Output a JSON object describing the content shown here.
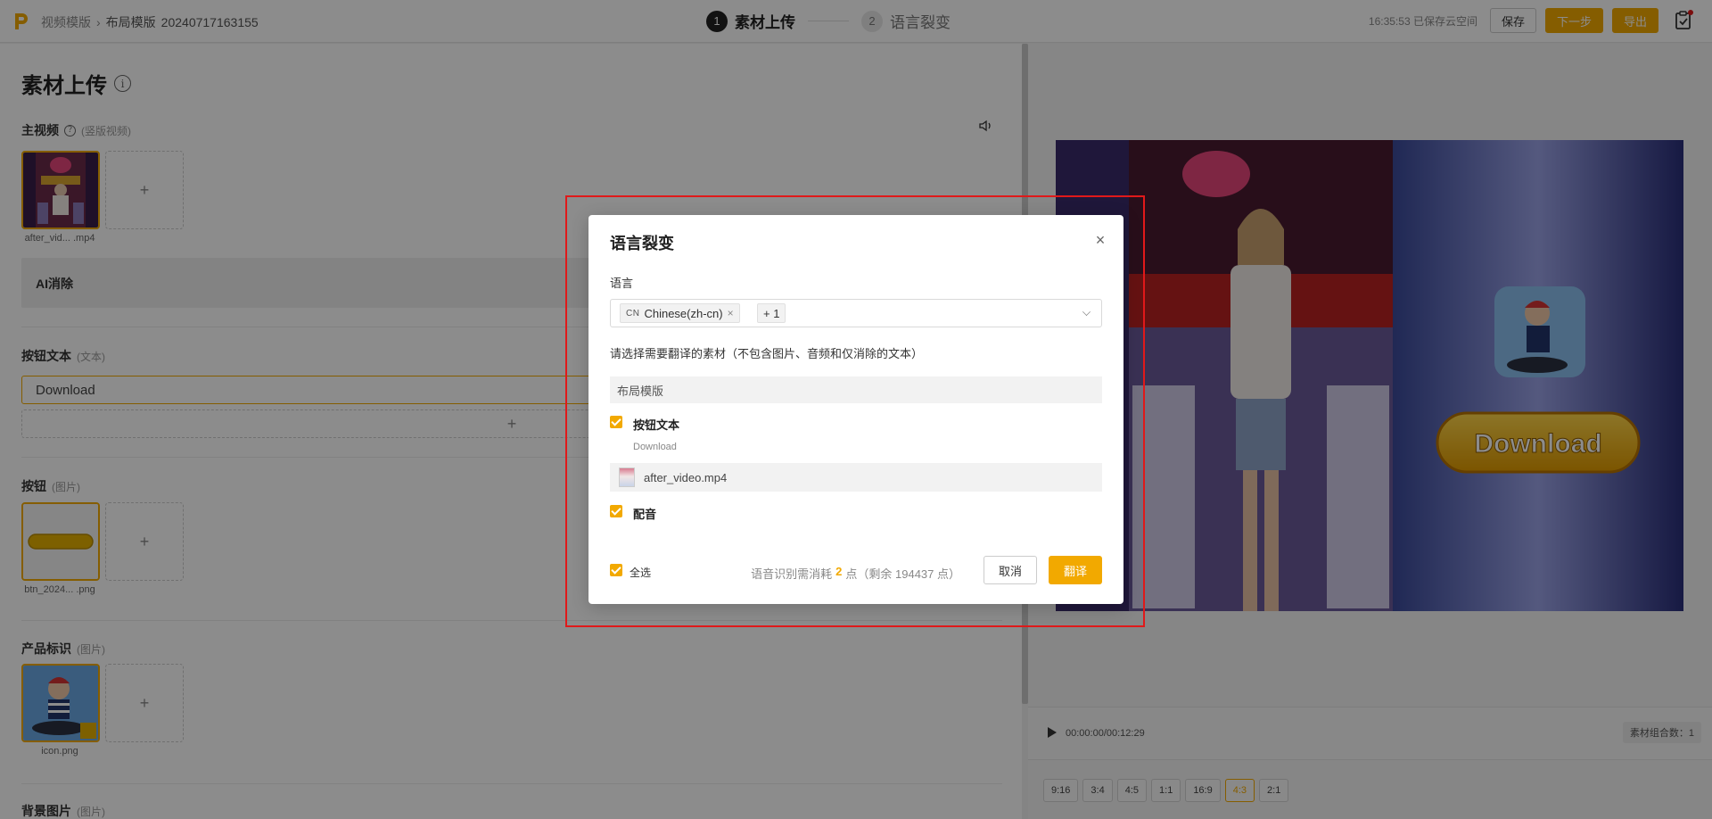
{
  "header": {
    "breadcrumbs": [
      "视频模版",
      "布局模版"
    ],
    "doc_title": "20240717163155",
    "steps": [
      {
        "num": "1",
        "label": "素材上传"
      },
      {
        "num": "2",
        "label": "语言裂变"
      }
    ],
    "save_status": "16:35:53 已保存云空间",
    "save_label": "保存",
    "next_label": "下一步",
    "export_label": "导出"
  },
  "left": {
    "page_title": "素材上传",
    "info_icon": "i",
    "main_video": {
      "label": "主视频",
      "help": "?",
      "sub": "(竖版视频)",
      "filename": "after_vid... .mp4"
    },
    "ai_label": "AI消除",
    "button_text": {
      "label": "按钮文本",
      "sub": "(文本)",
      "value": "Download"
    },
    "button_image": {
      "label": "按钮",
      "sub": "(图片)",
      "filename": "btn_2024... .png"
    },
    "product_logo": {
      "label": "产品标识",
      "sub": "(图片)",
      "filename": "icon.png"
    },
    "background": {
      "label": "背景图片",
      "sub": "(图片)"
    },
    "add_symbol": "+"
  },
  "preview": {
    "download_text": "Download",
    "timecode": "00:00:00/00:12:29",
    "combo": "素材组合数：1",
    "ratios": [
      "9:16",
      "3:4",
      "4:5",
      "1:1",
      "16:9",
      "4:3",
      "2:1"
    ],
    "active_ratio": "4:3"
  },
  "modal": {
    "title": "语言裂变",
    "close": "×",
    "language_label": "语言",
    "lang_tag": {
      "flag": "CN",
      "text": "Chinese(zh-cn)",
      "remove": "×"
    },
    "more_tag": "+ 1",
    "instruction": "请选择需要翻译的素材（不包含图片、音频和仅消除的文本）",
    "group": "布局模版",
    "item_button_text": "按钮文本",
    "item_button_sub": "Download",
    "file_name": "after_video.mp4",
    "item_dubbing": "配音",
    "select_all": "全选",
    "cost_prefix": "语音识别需消耗",
    "cost_value": "2",
    "cost_suffix": "点（剩余 194437 点）",
    "cancel": "取消",
    "translate": "翻译"
  },
  "colors": {
    "accent": "#f2a900",
    "highlight_box": "#e0191a"
  }
}
